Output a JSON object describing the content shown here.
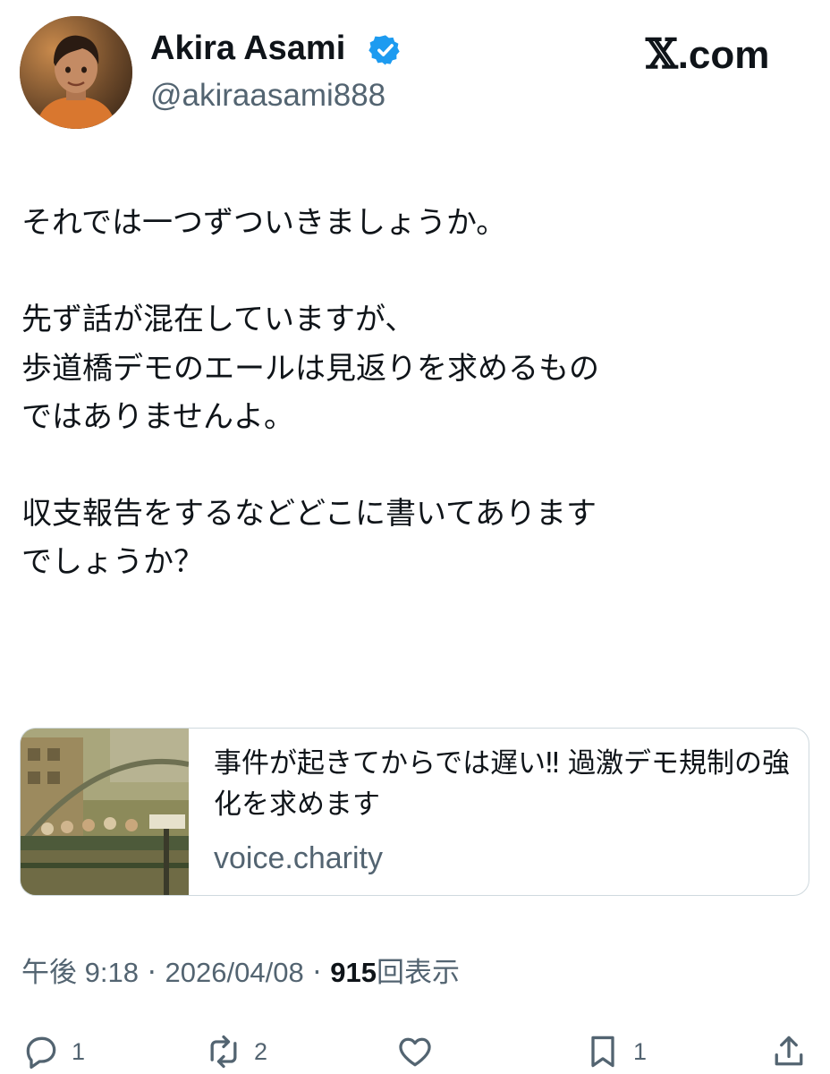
{
  "author": {
    "display_name": "Akira Asami",
    "handle": "@akiraasami888",
    "verified_icon": "verified-badge-icon",
    "avatar_icon": "avatar-photo"
  },
  "brand": {
    "text": ".com",
    "logo_icon": "x-logo-icon"
  },
  "tweet": {
    "lines": [
      "それでは一つずついきましょうか。",
      "",
      "先ず話が混在していますが、",
      "歩道橋デモのエールは見返りを求めるもの",
      "ではありませんよ。",
      "",
      "収支報告をするなどどこに書いてあります",
      "でしょうか？"
    ]
  },
  "link_card": {
    "title": "事件が起きてからでは遅い‼ 過激デモ規制の強化を求めます",
    "domain": "voice.charity",
    "thumbnail_icon": "link-thumbnail-image"
  },
  "meta": {
    "time": "午後 9:18",
    "separator": "·",
    "date": "2026/04/08",
    "views_count": "915",
    "views_label": "回表示"
  },
  "actions": {
    "reply": {
      "icon": "reply-icon",
      "count": "1"
    },
    "retweet": {
      "icon": "retweet-icon",
      "count": "2"
    },
    "like": {
      "icon": "heart-icon",
      "count": ""
    },
    "bookmark": {
      "icon": "bookmark-icon",
      "count": "1"
    },
    "share": {
      "icon": "share-icon",
      "count": ""
    }
  },
  "colors": {
    "text_primary": "#0f1419",
    "text_secondary": "#536471",
    "verified_blue": "#1d9bf0",
    "card_border": "#cfd9de"
  }
}
